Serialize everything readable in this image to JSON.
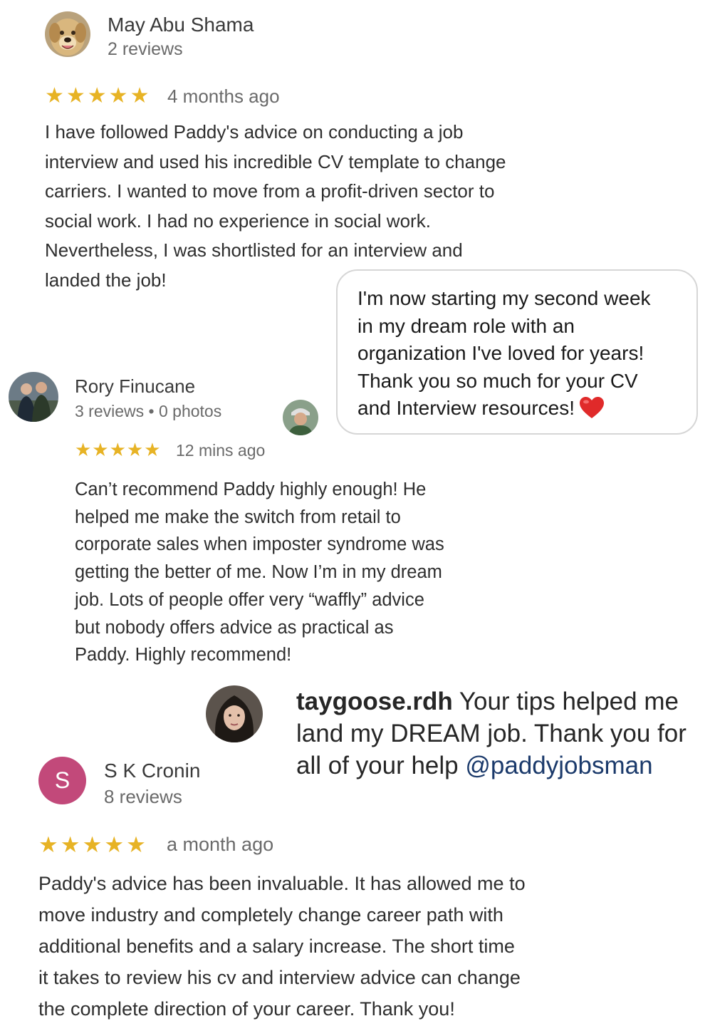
{
  "reviews": [
    {
      "name": "May Abu Shama",
      "meta": "2 reviews",
      "stars": "★★★★★",
      "time": "4 months ago",
      "text_lines": [
        "I have followed Paddy's advice on conducting a job",
        "interview and used his incredible CV template to change",
        "carriers. I wanted to move from a profit-driven sector to",
        "social work. I had no experience in social work.",
        "Nevertheless, I was shortlisted for an interview and",
        "landed the job!"
      ]
    },
    {
      "name": "Rory Finucane",
      "meta": "3 reviews • 0 photos",
      "stars": "★★★★★",
      "time": "12 mins ago",
      "text_lines": [
        "Can’t recommend Paddy highly enough! He",
        "helped me make the switch from retail to",
        "corporate sales when imposter syndrome was",
        "getting the better of me. Now I’m in my dream",
        "job. Lots of people offer very “waffly” advice",
        "but nobody offers advice as practical as",
        "Paddy. Highly recommend!"
      ]
    },
    {
      "name": "S K Cronin",
      "avatar_letter": "S",
      "meta": "8 reviews",
      "stars": "★★★★★",
      "time": "a month ago",
      "text_lines": [
        "Paddy's advice has been invaluable. It has allowed me to",
        "move industry and completely change career path with",
        "additional benefits and a salary increase. The short time",
        "it takes to review his cv and interview advice can change",
        "the complete direction of your career. Thank you!"
      ]
    }
  ],
  "message_bubble": {
    "lines": [
      "I'm now starting my second week",
      "in my dream role with an",
      "organization I've loved for years!",
      "Thank you so much for your CV",
      "and Interview resources!"
    ],
    "emoji": "heart-icon"
  },
  "instagram_comment": {
    "handle": "taygoose.rdh",
    "line1_rest": " Your tips helped me",
    "line2": "land my DREAM job. Thank you for",
    "line3_prefix": "all of your help ",
    "mention": "@paddyjobsman"
  },
  "colors": {
    "star": "#e7b325",
    "letter_avatar_bg": "#c2497a",
    "mention": "#1b3a6b",
    "heart": "#e02a2a"
  }
}
